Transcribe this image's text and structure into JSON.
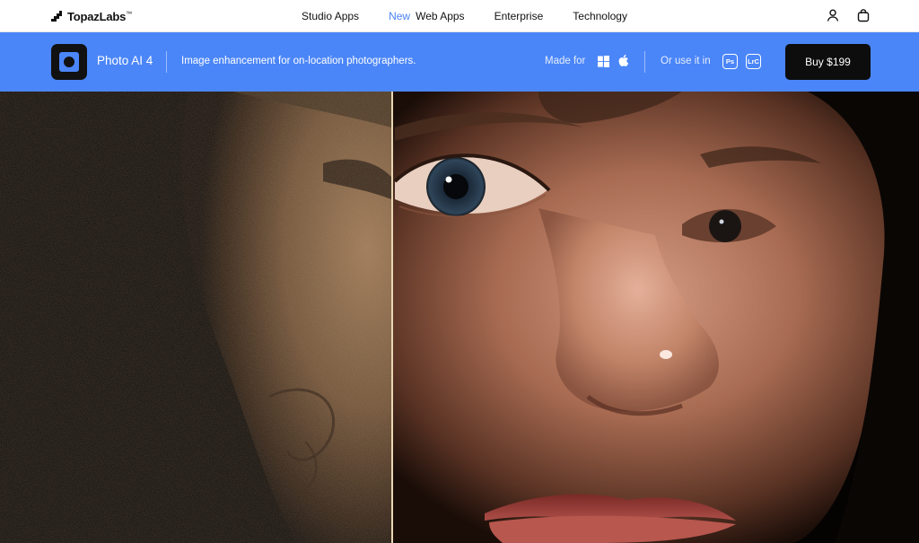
{
  "nav": {
    "logo": "TopazLabs",
    "logo_tm": "™",
    "links": [
      {
        "label": "Studio Apps"
      },
      {
        "badge": "New",
        "label": "Web Apps"
      },
      {
        "label": "Enterprise"
      },
      {
        "label": "Technology"
      }
    ],
    "icons": [
      "user-icon",
      "shopping-bag-icon"
    ]
  },
  "banner": {
    "product": "Photo AI 4",
    "tagline": "Image enhancement for on-location photographers.",
    "made_for": "Made for",
    "os_icons": [
      "windows-icon",
      "apple-icon"
    ],
    "or_use": "Or use it in",
    "plugins": [
      "Ps",
      "LrC"
    ],
    "buy_label": "Buy",
    "price": "$199",
    "accent": "#4b86f8"
  },
  "compare": {
    "split_fraction": 0.426
  }
}
